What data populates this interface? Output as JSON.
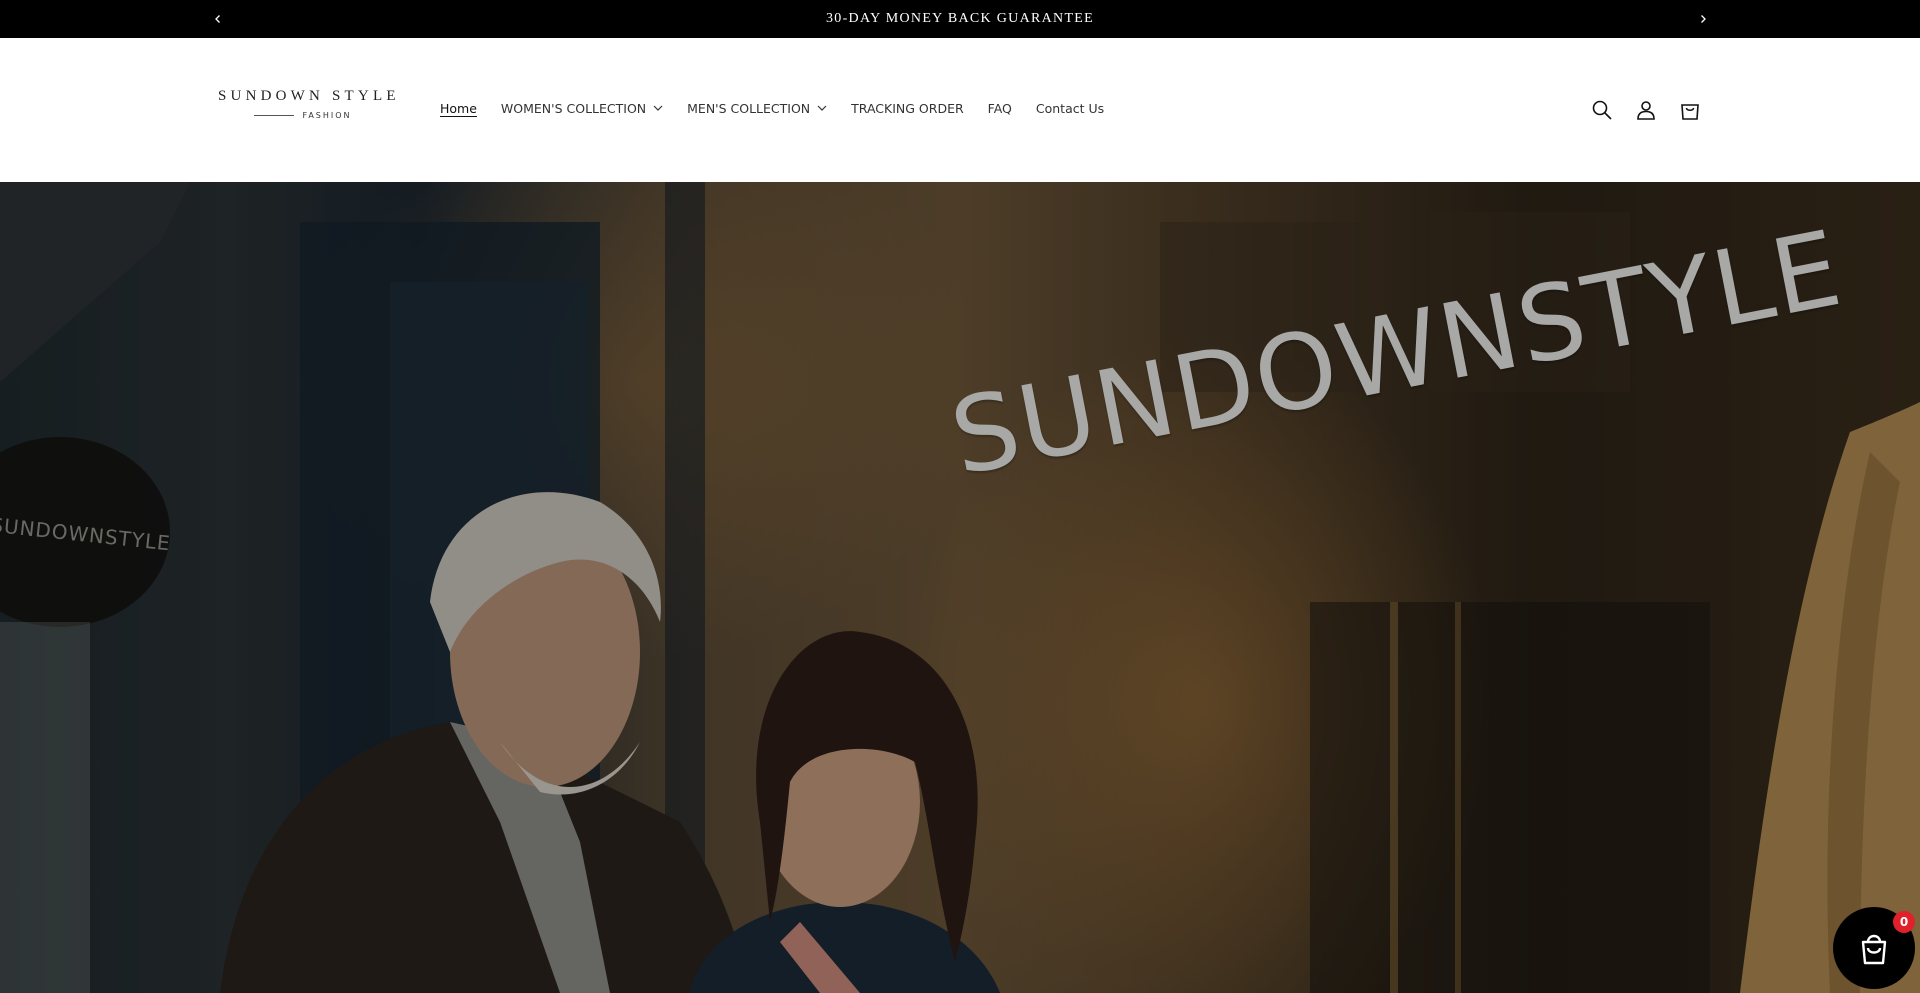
{
  "announcement": {
    "text": "30-DAY MONEY BACK GUARANTEE",
    "prev_icon": "chevron-left-icon",
    "next_icon": "chevron-right-icon"
  },
  "logo": {
    "name": "SUNDOWN STYLE",
    "tagline": "FASHION"
  },
  "nav": {
    "items": [
      {
        "label": "Home",
        "active": true
      },
      {
        "label": "WOMEN'S COLLECTION",
        "dropdown": true
      },
      {
        "label": "MEN'S COLLECTION",
        "dropdown": true
      },
      {
        "label": "TRACKING ORDER"
      },
      {
        "label": "FAQ"
      },
      {
        "label": "Contact Us"
      }
    ]
  },
  "header_icons": [
    "search-icon",
    "account-icon",
    "cart-icon"
  ],
  "hero": {
    "storefront_sign": "SUNDOWNSTYLE",
    "awning_sign": "SUNDOWNSTYLE"
  },
  "floating_cart": {
    "icon": "shopping-bag-icon",
    "count": "0",
    "badge_color": "#e0212b"
  },
  "colors": {
    "announcement_bg": "#000000",
    "header_bg": "#ffffff",
    "text": "#121212"
  }
}
